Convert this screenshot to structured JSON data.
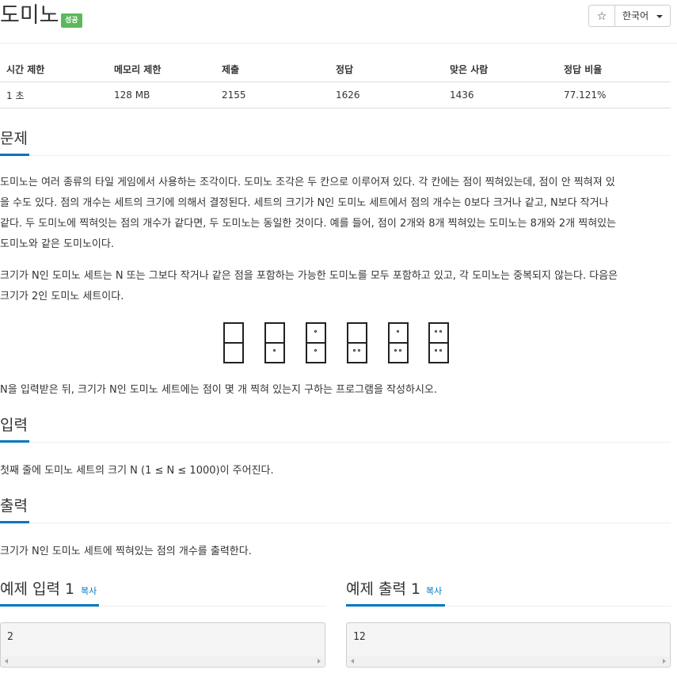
{
  "problem": {
    "title": "도미노",
    "badge": "성공",
    "star_label": "☆",
    "language": "한국어"
  },
  "info_table": {
    "headers": [
      "시간 제한",
      "메모리 제한",
      "제출",
      "정답",
      "맞은 사람",
      "정답 비율"
    ],
    "row": [
      "1 초",
      "128 MB",
      "2155",
      "1626",
      "1436",
      "77.121%"
    ]
  },
  "sections": {
    "problem_heading": "문제",
    "problem_p1_lines": [
      "도미노는 여러 종류의 타일 게임에서 사용하는 조각이다. 도미노 조각은 두 칸으로 이루어져 있다. 각 칸에는 점이 찍혀있는데, 점이 안 찍혀져 있",
      "을 수도 있다. 점의 개수는 세트의 크기에 의해서 결정된다. 세트의 크기가 N인 도미노 세트에서 점의 개수는 0보다 크거나 같고, N보다 작거나",
      "같다. 두 도미노에 찍혀잇는 점의 개수가 같다면, 두 도미노는 동일한 것이다. 예를 들어, 점이 2개와 8개 찍혀있는 도미노는 8개와 2개 찍혀있는",
      "도미노와 같은 도미노이다."
    ],
    "problem_p2_lines": [
      "크기가 N인 도미노 세트는 N 또는 그보다 작거나 같은 점을 포함하는 가능한 도미노를 모두 포함하고 있고, 각 도미노는 중복되지 않는다. 다음은",
      "크기가 2인 도미노 세트이다."
    ],
    "problem_p3": "N을 입력받은 뒤, 크기가 N인 도미노 세트에는 점이 몇 개 찍혀 있는지 구하는 프로그램을 작성하시오.",
    "input_heading": "입력",
    "input_text": "첫째 줄에 도미노 세트의 크기 N (1 ≤ N ≤ 1000)이 주어진다.",
    "output_heading": "출력",
    "output_text": "크기가 N인 도미노 세트에 찍혀있는 점의 개수를 출력한다."
  },
  "dominoes": [
    [
      0,
      0
    ],
    [
      0,
      1
    ],
    [
      1,
      1
    ],
    [
      0,
      2
    ],
    [
      1,
      2
    ],
    [
      2,
      2
    ]
  ],
  "samples": {
    "input_heading": "예제 입력 1",
    "output_heading": "예제 출력 1",
    "copy_label": "복사",
    "input_value": "2",
    "output_value": "12"
  },
  "colors": {
    "accent": "#0076c0",
    "badge_success": "#5cb85c"
  }
}
